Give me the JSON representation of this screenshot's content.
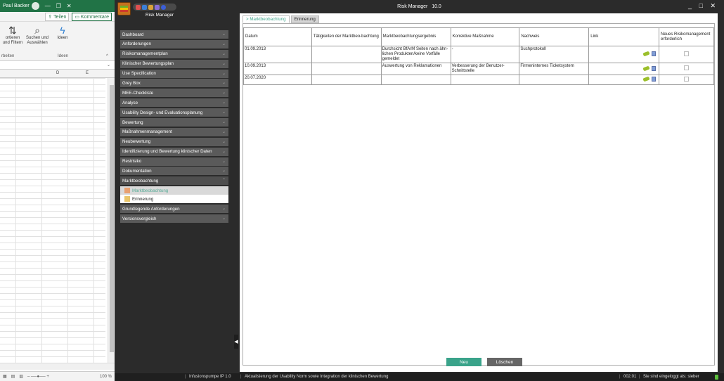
{
  "excel": {
    "user": "Paul Backer",
    "share": "Teilen",
    "comments": "Kommentare",
    "groups": {
      "sort_label": "ortieren und Filtern",
      "find_label": "Suchen und Auswählen",
      "ideas_label": "Ideen",
      "group_editing": "rbeiten",
      "group_ideas": "Ideen"
    },
    "columns": [
      "D",
      "E"
    ],
    "zoom": "100 %"
  },
  "app": {
    "window_title": "Risk Manager",
    "version": "10.0",
    "app_label": "Risk Manager",
    "sidebar": [
      {
        "label": "Dashboard"
      },
      {
        "label": "Anforderungen"
      },
      {
        "label": "Risikomanagementplan"
      },
      {
        "label": "Klinischer Bewertungsplan"
      },
      {
        "label": "Use Specification"
      },
      {
        "label": "Grey Box"
      },
      {
        "label": "MEE-Checkliste"
      },
      {
        "label": "Analyse"
      },
      {
        "label": "Usability Design- und Evaluationsplanung"
      },
      {
        "label": "Bewertung"
      },
      {
        "label": "Maßnahmenmanagement"
      },
      {
        "label": "Neubewertung"
      },
      {
        "label": "Identifizierung und Bewertung klinischer Daten"
      },
      {
        "label": "Restrisiko"
      },
      {
        "label": "Dokumentation"
      },
      {
        "label": "Marktbeobachtung"
      }
    ],
    "sidebar_sub": [
      {
        "label": "Marktbeobachtung"
      },
      {
        "label": "Erinnerung"
      }
    ],
    "sidebar_after": [
      {
        "label": "Grundlegende Anforderungen"
      },
      {
        "label": "Versionsvergleich"
      }
    ],
    "tabs": [
      "> Marktbeobachtung",
      "Erinnerung"
    ],
    "table": {
      "headers": [
        "Datum",
        "Tätigkeiten der Marktbeo-bachtung",
        "Marktbeobachtungsergebnis",
        "Korrektive Maßnahme",
        "Nachweis",
        "Link",
        "Neues Risikomanagement erforderlich"
      ],
      "rows": [
        {
          "datum": "01.09.2013",
          "taetigkeit": "",
          "ergebnis": "Durchsicht BfArM Seiten nach ähn-lichen Produkten/keine Vorfälle gemeldet",
          "massnahme": "-",
          "nachweis": "Suchprotokoll"
        },
        {
          "datum": "10.09.2013",
          "taetigkeit": "",
          "ergebnis": "Auswertung von Reklamationen",
          "massnahme": "Verbesserung der Benutzer-Schnittstelle",
          "nachweis": "Firmeninternes Ticketsystem"
        },
        {
          "datum": "20.07.2020",
          "taetigkeit": "",
          "ergebnis": "",
          "massnahme": "",
          "nachweis": ""
        }
      ]
    },
    "buttons": {
      "new": "Neu",
      "delete": "Löschen"
    },
    "status": {
      "project": "Infusionspumpe IP 1.0",
      "description": "Aktualisierung der Usability Norm sowie Integration der klinischen Bewertung",
      "code": "002.01",
      "login": "Sie sind eingeloggt als: sieber"
    }
  }
}
